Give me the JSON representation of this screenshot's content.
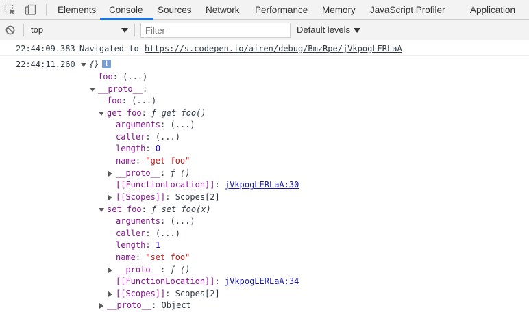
{
  "tabs": [
    {
      "label": "Elements"
    },
    {
      "label": "Console"
    },
    {
      "label": "Sources"
    },
    {
      "label": "Network"
    },
    {
      "label": "Performance"
    },
    {
      "label": "Memory"
    },
    {
      "label": "JavaScript Profiler"
    },
    {
      "label": "Application"
    }
  ],
  "active_tab": "Console",
  "toolbar": {
    "context": "top",
    "filter_placeholder": "Filter",
    "levels": "Default levels"
  },
  "console": {
    "nav": {
      "timestamp": "22:44:09.383",
      "text": "Navigated to",
      "url": "https://s.codepen.io/airen/debug/BmzRpe/jVkpogLERLaA"
    },
    "log": {
      "timestamp": "22:44:11.260",
      "summary": "{}",
      "info_badge": "i",
      "rows": [
        {
          "key": "foo",
          "value": "(...)"
        },
        {
          "key": "__proto__",
          "value": ""
        },
        {
          "key": "foo",
          "value": "(...)"
        },
        {
          "key": "get foo",
          "value": "ƒ get foo()"
        },
        {
          "key": "arguments",
          "value": "(...)"
        },
        {
          "key": "caller",
          "value": "(...)"
        },
        {
          "key": "length",
          "value": "0"
        },
        {
          "key": "name",
          "value": "\"get foo\""
        },
        {
          "key": "__proto__",
          "value": "ƒ ()"
        },
        {
          "key": "[[FunctionLocation]]",
          "value": "jVkpogLERLaA:30"
        },
        {
          "key": "[[Scopes]]",
          "value": "Scopes[2]"
        },
        {
          "key": "set foo",
          "value": "ƒ set foo(x)"
        },
        {
          "key": "arguments",
          "value": "(...)"
        },
        {
          "key": "caller",
          "value": "(...)"
        },
        {
          "key": "length",
          "value": "1"
        },
        {
          "key": "name",
          "value": "\"set foo\""
        },
        {
          "key": "__proto__",
          "value": "ƒ ()"
        },
        {
          "key": "[[FunctionLocation]]",
          "value": "jVkpogLERLaA:34"
        },
        {
          "key": "[[Scopes]]",
          "value": "Scopes[2]"
        },
        {
          "key": "__proto__",
          "value": "Object"
        }
      ]
    }
  },
  "colors": {
    "accent": "#1a73e8",
    "key": "#881391",
    "number": "#1c00cf",
    "string": "#c41a16",
    "link": "#1a1aa6"
  }
}
